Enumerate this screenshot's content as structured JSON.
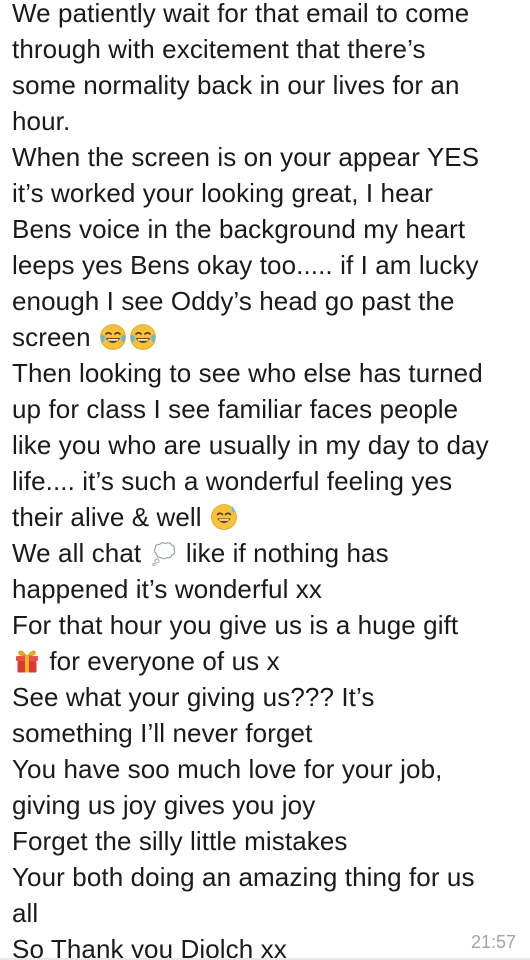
{
  "message": {
    "lines": [
      "We patiently wait for that email to come",
      "through with excitement that there’s",
      "some normality back in our lives for an",
      "hour.",
      "When the screen is on your appear YES",
      "it’s worked your looking great, I hear",
      "Bens voice in the background my heart",
      "leeps yes Bens okay too..... if I am lucky",
      "enough I see Oddy’s head go past the",
      "screen",
      "Then looking to see who else has turned",
      "up for class I see familiar faces people",
      "like you who are usually in my day to day",
      "life.... it’s such a wonderful feeling yes",
      "their alive & well",
      "We all chat",
      "like if nothing has",
      "happened it’s wonderful xx",
      "For that hour you give us is a huge gift",
      "for everyone of us x",
      "See what your giving us??? It’s",
      "something I’ll never forget",
      "You have soo much love for your job,",
      "giving us joy gives you joy",
      "Forget the silly little mistakes",
      "Your both doing an amazing thing for us",
      "all",
      "So Thank you Diolch xx"
    ],
    "timestamp": "21:57"
  },
  "icons": {
    "laughing_tears": "face-with-tears-of-joy-icon",
    "sweat_smile": "grinning-face-with-sweat-icon",
    "thought_balloon": "thought-balloon-icon",
    "gift": "wrapped-gift-icon"
  },
  "colors": {
    "text": "#1a1a1a",
    "timestamp": "#a4a4a4",
    "background": "#ffffff"
  }
}
